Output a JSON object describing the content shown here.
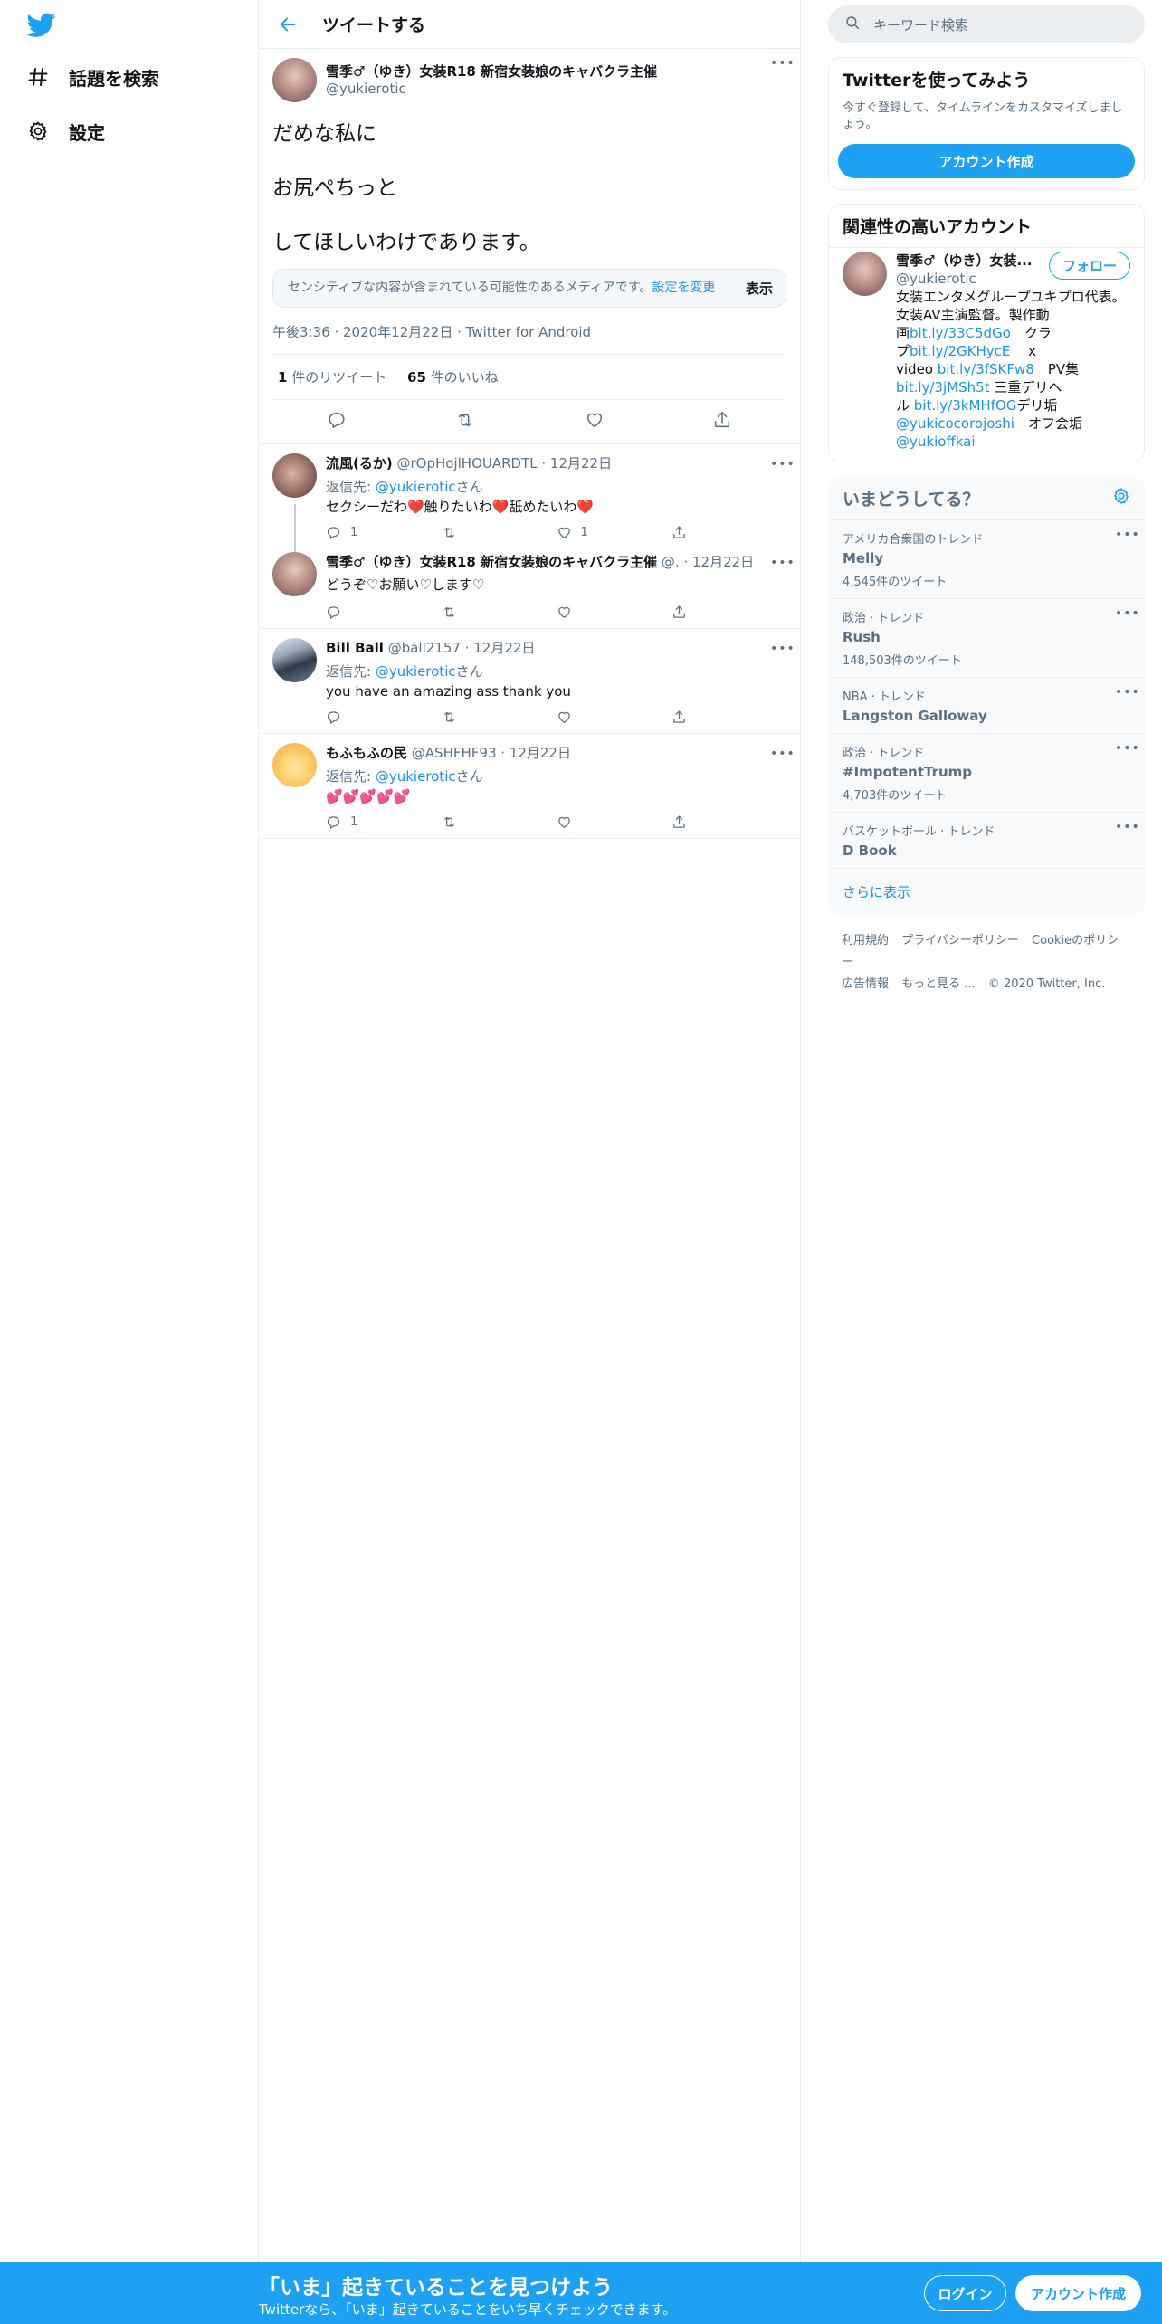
{
  "nav": {
    "logo": "twitter-bird-icon",
    "items": [
      {
        "label": "話題を検索",
        "icon": "hashtag-icon"
      },
      {
        "label": "設定",
        "icon": "gear-icon"
      }
    ]
  },
  "header": {
    "title": "ツイートする"
  },
  "focus_tweet": {
    "name": "雪季♂（ゆき）女装R18 新宿女装娘のキャバクラ主催",
    "handle": "@yukierotic",
    "text": "だめな私に\n\nお尻ぺちっと\n\nしてほしいわけであります。",
    "sensitive_text": "センシティブな内容が含まれている可能性のあるメディアです。",
    "sensitive_link": "設定を変更",
    "show_label": "表示",
    "time": "午後3:36 · 2020年12月22日 · Twitter for Android",
    "retweets": "1",
    "retweets_label": "件のリツイート",
    "likes": "65",
    "likes_label": "件のいいね"
  },
  "replies": [
    {
      "name": "流風(るか)",
      "handle": "@rOpHojlHOUARDTL",
      "date": "· 12月22日",
      "replyto_prefix": "返信先: ",
      "replyto_handle": "@yukierotic",
      "replyto_suffix": "さん",
      "text": "セクシーだわ❤️触りたいわ❤️舐めたいわ❤️",
      "reply_count": "1",
      "retweet_count": "",
      "like_count": "1"
    },
    {
      "name": "雪季♂（ゆき）女装R18 新宿女装娘のキャバクラ主催",
      "handle": "@.",
      "date": "· 12月22日",
      "text": "どうぞ♡お願い♡します♡",
      "reply_count": "",
      "retweet_count": "",
      "like_count": ""
    },
    {
      "name": "Bill Ball",
      "handle": "@ball2157",
      "date": "· 12月22日",
      "replyto_prefix": "返信先: ",
      "replyto_handle": "@yukierotic",
      "replyto_suffix": "さん",
      "text": "you have an amazing ass thank you",
      "reply_count": "",
      "retweet_count": "",
      "like_count": ""
    },
    {
      "name": "もふもふの民",
      "handle": "@ASHFHF93",
      "date": "· 12月22日",
      "replyto_prefix": "返信先: ",
      "replyto_handle": "@yukierotic",
      "replyto_suffix": "さん",
      "text": "💕💕💕💕💕",
      "reply_count": "1",
      "retweet_count": "",
      "like_count": ""
    }
  ],
  "search": {
    "placeholder": "キーワード検索"
  },
  "signup_card": {
    "title": "Twitterを使ってみよう",
    "subtitle": "今すぐ登録して、タイムラインをカスタマイズしましょう。",
    "button": "アカウント作成"
  },
  "related": {
    "title": "関連性の高いアカウント",
    "name": "雪季♂（ゆき）女装...",
    "handle": "@yukierotic",
    "follow": "フォロー",
    "bio": [
      {
        "t": "女装エンタメグループユキプロ代表。"
      },
      {
        "t": "女装AV主演監督。製作動"
      },
      {
        "t": "画",
        "l": "bit.ly/33C5dGo",
        "t2": "　クラ"
      },
      {
        "t": "プ",
        "l": "bit.ly/2GKHycE",
        "t2": "　 x"
      },
      {
        "t": "video ",
        "l": "bit.ly/3fSKFw8",
        "t2": "　PV集"
      },
      {
        "t": "",
        "l": "bit.ly/3jMSh5t",
        "t2": " 三重デリヘ"
      },
      {
        "t": "ル ",
        "l": "bit.ly/3kMHfOG",
        "t2": "デリ垢"
      },
      {
        "t": "",
        "l": "@yukicocorojoshi",
        "t2": "　オフ会垢"
      },
      {
        "t": "",
        "l": "@yukioffkai",
        "t2": ""
      }
    ]
  },
  "trends": {
    "title": "いまどうしてる？",
    "items": [
      {
        "category": "アメリカ合衆国のトレンド",
        "topic": "Melly",
        "count": "4,545件のツイート"
      },
      {
        "category": "政治 · トレンド",
        "topic": "Rush",
        "count": "148,503件のツイート"
      },
      {
        "category": "NBA · トレンド",
        "topic": "Langston Galloway",
        "count": ""
      },
      {
        "category": "政治 · トレンド",
        "topic": "#ImpotentTrump",
        "count": "4,703件のツイート"
      },
      {
        "category": "バスケットボール · トレンド",
        "topic": "D Book",
        "count": ""
      }
    ],
    "show_more": "さらに表示"
  },
  "footer": {
    "line1": [
      "利用規約",
      "プライバシーポリシー",
      "Cookieのポリシー"
    ],
    "line2": [
      "広告情報",
      "もっと見る ...",
      "© 2020 Twitter, Inc."
    ]
  },
  "bottom_bar": {
    "headline": "「いま」起きていることを見つけよう",
    "sub": "Twitterなら、「いま」起きていることをいち早くチェックできます。",
    "login": "ログイン",
    "signup": "アカウント作成"
  },
  "colors": {
    "accent": "#1da1f2",
    "link": "#1b95e0",
    "muted": "#5b7083"
  }
}
